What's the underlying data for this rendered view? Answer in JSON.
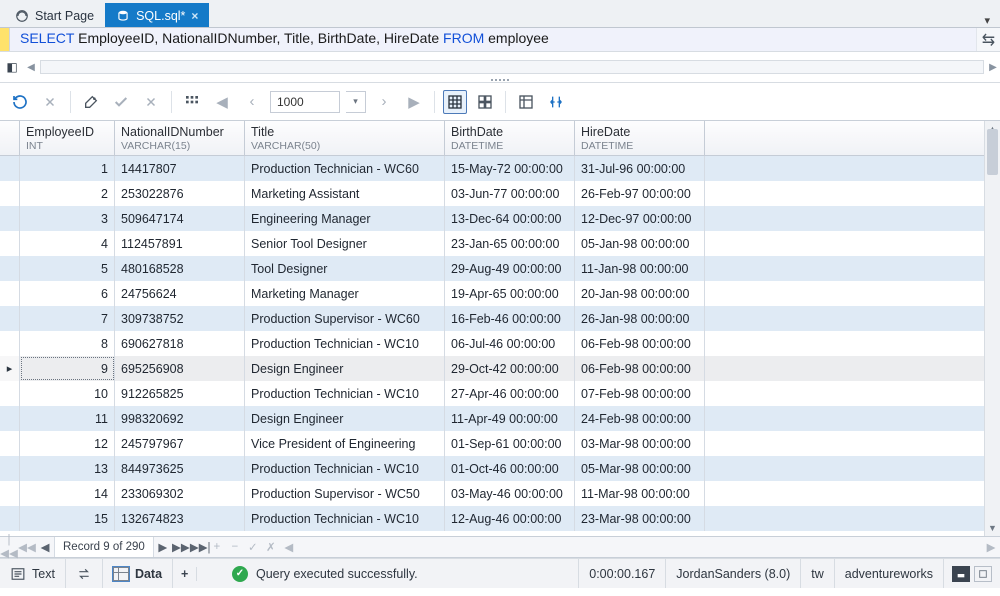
{
  "tabs": {
    "start": "Start Page",
    "file": "SQL.sql*",
    "close": "×"
  },
  "sql": {
    "select": "SELECT",
    "from": "FROM",
    "body": " EmployeeID, NationalIDNumber, Title, BirthDate, HireDate ",
    "table": " employee"
  },
  "toolbar": {
    "page_size": "1000"
  },
  "columns": [
    {
      "name": "EmployeeID",
      "type": "INT"
    },
    {
      "name": "NationalIDNumber",
      "type": "VARCHAR(15)"
    },
    {
      "name": "Title",
      "type": "VARCHAR(50)"
    },
    {
      "name": "BirthDate",
      "type": "DATETIME"
    },
    {
      "name": "HireDate",
      "type": "DATETIME"
    }
  ],
  "rows": [
    {
      "id": "1",
      "nid": "14417807",
      "title": "Production Technician - WC60",
      "birth": "15-May-72 00:00:00",
      "hire": "31-Jul-96 00:00:00"
    },
    {
      "id": "2",
      "nid": "253022876",
      "title": "Marketing Assistant",
      "birth": "03-Jun-77 00:00:00",
      "hire": "26-Feb-97 00:00:00"
    },
    {
      "id": "3",
      "nid": "509647174",
      "title": "Engineering Manager",
      "birth": "13-Dec-64 00:00:00",
      "hire": "12-Dec-97 00:00:00"
    },
    {
      "id": "4",
      "nid": "112457891",
      "title": "Senior Tool Designer",
      "birth": "23-Jan-65 00:00:00",
      "hire": "05-Jan-98 00:00:00"
    },
    {
      "id": "5",
      "nid": "480168528",
      "title": "Tool Designer",
      "birth": "29-Aug-49 00:00:00",
      "hire": "11-Jan-98 00:00:00"
    },
    {
      "id": "6",
      "nid": "24756624",
      "title": "Marketing Manager",
      "birth": "19-Apr-65 00:00:00",
      "hire": "20-Jan-98 00:00:00"
    },
    {
      "id": "7",
      "nid": "309738752",
      "title": "Production Supervisor - WC60",
      "birth": "16-Feb-46 00:00:00",
      "hire": "26-Jan-98 00:00:00"
    },
    {
      "id": "8",
      "nid": "690627818",
      "title": "Production Technician - WC10",
      "birth": "06-Jul-46 00:00:00",
      "hire": "06-Feb-98 00:00:00"
    },
    {
      "id": "9",
      "nid": "695256908",
      "title": "Design Engineer",
      "birth": "29-Oct-42 00:00:00",
      "hire": "06-Feb-98 00:00:00"
    },
    {
      "id": "10",
      "nid": "912265825",
      "title": "Production Technician - WC10",
      "birth": "27-Apr-46 00:00:00",
      "hire": "07-Feb-98 00:00:00"
    },
    {
      "id": "11",
      "nid": "998320692",
      "title": "Design Engineer",
      "birth": "11-Apr-49 00:00:00",
      "hire": "24-Feb-98 00:00:00"
    },
    {
      "id": "12",
      "nid": "245797967",
      "title": "Vice President of Engineering",
      "birth": "01-Sep-61 00:00:00",
      "hire": "03-Mar-98 00:00:00"
    },
    {
      "id": "13",
      "nid": "844973625",
      "title": "Production Technician - WC10",
      "birth": "01-Oct-46 00:00:00",
      "hire": "05-Mar-98 00:00:00"
    },
    {
      "id": "14",
      "nid": "233069302",
      "title": "Production Supervisor - WC50",
      "birth": "03-May-46 00:00:00",
      "hire": "11-Mar-98 00:00:00"
    },
    {
      "id": "15",
      "nid": "132674823",
      "title": "Production Technician - WC10",
      "birth": "12-Aug-46 00:00:00",
      "hire": "23-Mar-98 00:00:00"
    }
  ],
  "selected_row_index": 8,
  "nav": {
    "record": "Record 9 of 290"
  },
  "footer": {
    "text_tab": "Text",
    "data_tab": "Data",
    "message": "Query executed successfully.",
    "elapsed": "0:00:00.167",
    "user": "JordanSanders (8.0)",
    "schema": "tw",
    "db": "adventureworks"
  }
}
